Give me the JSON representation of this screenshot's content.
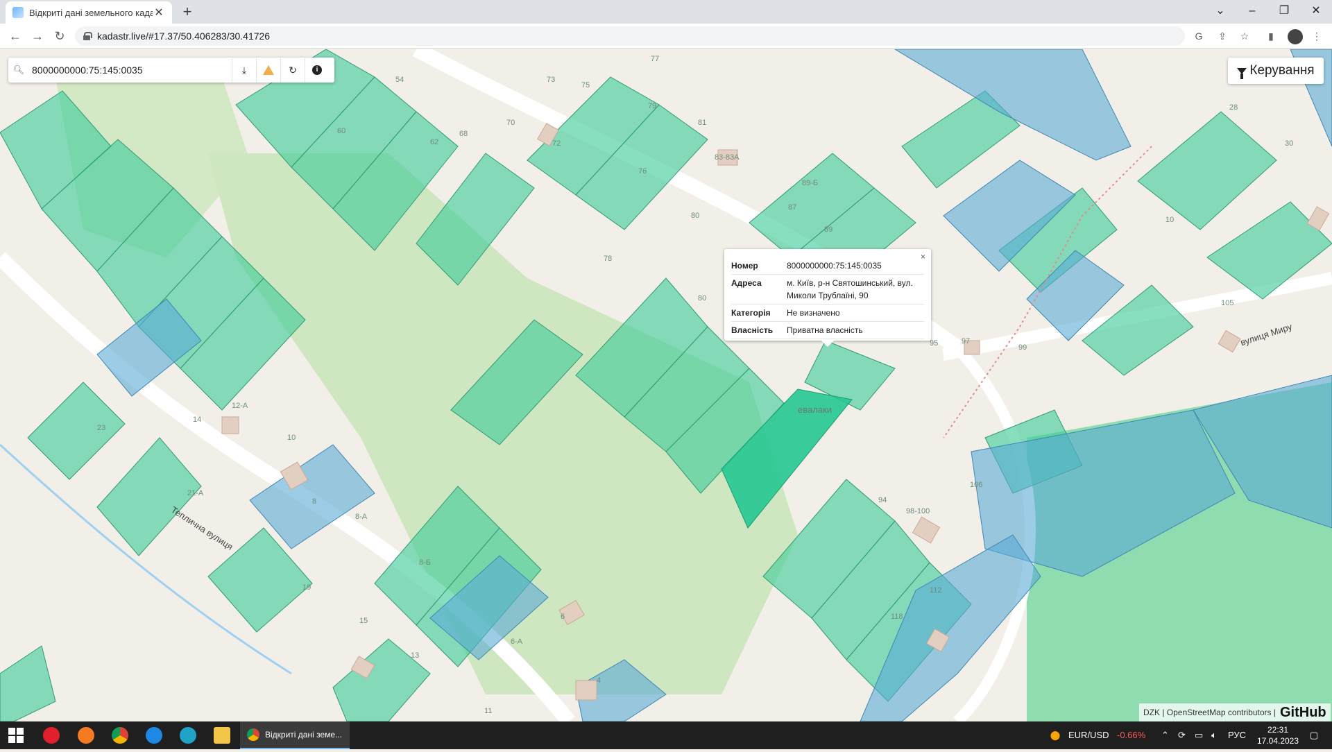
{
  "browser": {
    "tab_title": "Відкриті дані земельного кадас",
    "tab_close": "✕",
    "new_tab": "+",
    "url": "kadastr.live/#17.37/50.406283/30.41726",
    "icons": [
      "back-icon",
      "forward-icon",
      "reload-icon",
      "lock-icon",
      "google-icon",
      "share-icon",
      "star-icon",
      "sidepanel-icon",
      "profile-icon",
      "menu-icon"
    ]
  },
  "search": {
    "value": "8000000000:75:145:0035",
    "buttons": [
      "download-icon",
      "warning-icon",
      "refresh-icon",
      "info-icon"
    ]
  },
  "controls": {
    "label": "Керування"
  },
  "popup": {
    "close": "×",
    "rows": [
      {
        "key": "Номер",
        "value": "8000000000:75:145:0035"
      },
      {
        "key": "Адреса",
        "value": "м. Київ, р-н Святошинський, вул. Миколи Трублаїні, 90"
      },
      {
        "key": "Категорія",
        "value": "Не визначено"
      },
      {
        "key": "Власність",
        "value": "Приватна власність"
      }
    ]
  },
  "map": {
    "streets": [
      "Теплична вулиця",
      "вулиця Миру",
      "евалаки"
    ],
    "parcel_labels": [
      "54",
      "60",
      "62",
      "68",
      "70",
      "72",
      "73",
      "75",
      "77",
      "79",
      "81",
      "76",
      "80",
      "83-83А",
      "78",
      "80",
      "87",
      "89-Б",
      "89",
      "95",
      "97",
      "99",
      "105",
      "10",
      "28",
      "30",
      "12-А",
      "14",
      "10",
      "23",
      "21-А",
      "8",
      "8-А",
      "8-Б",
      "6-А",
      "6",
      "4",
      "19",
      "15",
      "13",
      "11",
      "94",
      "98-100",
      "106",
      "112",
      "118"
    ],
    "colors": {
      "parcel_green": "#3fcc9a",
      "parcel_blue": "#5aaad6",
      "selected": "#25c791",
      "park": "#c8e6b8",
      "background": "#f2efe9",
      "road": "#ffffff"
    }
  },
  "attribution": {
    "text": "DZK | OpenStreetMap contributors |",
    "github": "GitHub"
  },
  "taskbar": {
    "active_app": "Відкриті дані земе...",
    "currency": "EUR/USD",
    "change": "-0.66%",
    "lang": "РУС",
    "time": "22:31",
    "date": "17.04.2023"
  }
}
